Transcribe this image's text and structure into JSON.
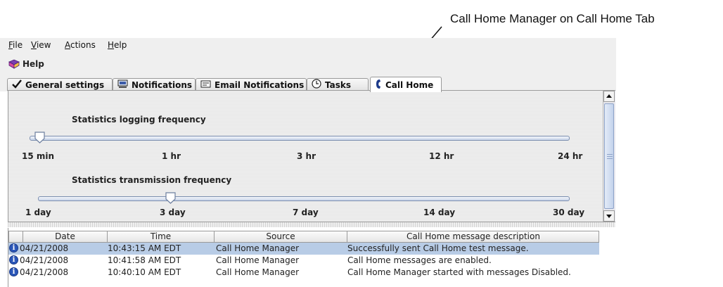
{
  "callout": {
    "text": "Call Home Manager on Call Home Tab"
  },
  "menu": {
    "file": "File",
    "view": "View",
    "actions": "Actions",
    "help": "Help"
  },
  "toolbar": {
    "help_label": "Help"
  },
  "tabs": [
    {
      "label": "General settings",
      "icon": "check-icon"
    },
    {
      "label": "Notifications",
      "icon": "monitor-icon"
    },
    {
      "label": "Email Notifications",
      "icon": "email-icon"
    },
    {
      "label": "Tasks",
      "icon": "clock-icon"
    },
    {
      "label": "Call Home",
      "icon": "phone-icon",
      "active": true
    }
  ],
  "sliders": {
    "logging": {
      "label": "Statistics logging frequency",
      "ticks": [
        "15 min",
        "1 hr",
        "3 hr",
        "12 hr",
        "24 hr"
      ],
      "selected": "15 min"
    },
    "transmission": {
      "label": "Statistics transmission frequency",
      "ticks": [
        "1 day",
        "3 day",
        "7 day",
        "14 day",
        "30 day"
      ],
      "selected": "3 day"
    }
  },
  "table": {
    "columns": [
      "Date",
      "Time",
      "Source",
      "Call Home message description"
    ],
    "rows": [
      {
        "date": "04/21/2008",
        "time": "10:43:15 AM EDT",
        "source": "Call Home Manager",
        "description": "Successfully sent Call Home test message.",
        "selected": true
      },
      {
        "date": "04/21/2008",
        "time": "10:41:58 AM EDT",
        "source": "Call Home Manager",
        "description": "Call Home messages are enabled."
      },
      {
        "date": "04/21/2008",
        "time": "10:40:10 AM EDT",
        "source": "Call Home Manager",
        "description": "Call Home Manager started with messages Disabled."
      }
    ]
  },
  "colors": {
    "selection": "#b8cce6",
    "slider_track": "#c8d3e8",
    "info_icon": "#2a56b8"
  }
}
